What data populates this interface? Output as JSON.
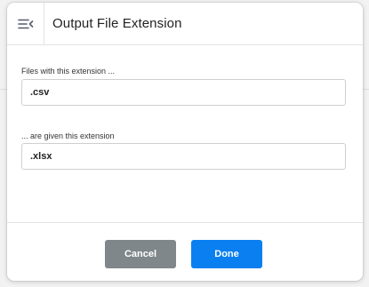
{
  "dialog": {
    "title": "Output File Extension",
    "menu_icon": "collapse-menu-icon"
  },
  "fields": {
    "source": {
      "label": "Files with this extension ...",
      "value": ".csv"
    },
    "target": {
      "label": "... are given this extension",
      "value": ".xlsx"
    }
  },
  "footer": {
    "cancel_label": "Cancel",
    "done_label": "Done"
  },
  "colors": {
    "cancel_bg": "#7f878b",
    "done_bg": "#0a7ff0"
  }
}
